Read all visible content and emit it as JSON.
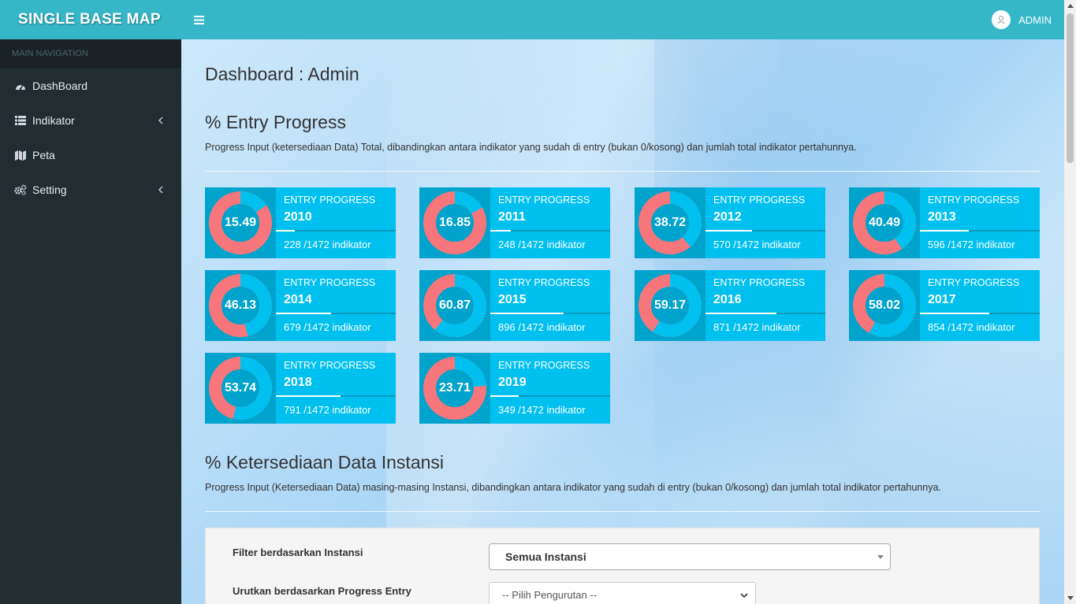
{
  "header": {
    "brand": "SINGLE BASE MAP",
    "user_name": "ADMIN"
  },
  "sidebar": {
    "section_label": "MAIN NAVIGATION",
    "items": [
      {
        "label": "DashBoard",
        "icon": "dashboard-icon",
        "has_children": false
      },
      {
        "label": "Indikator",
        "icon": "table-list-icon",
        "has_children": true
      },
      {
        "label": "Peta",
        "icon": "map-icon",
        "has_children": false
      },
      {
        "label": "Setting",
        "icon": "gears-icon",
        "has_children": true
      }
    ]
  },
  "main": {
    "page_title": "Dashboard : Admin",
    "entry_section": {
      "title": "% Entry Progress",
      "description": "Progress Input (ketersediaan Data) Total, dibandingkan antara indikator yang sudah di entry (bukan 0/kosong) dan jumlah total indikator pertahunnya."
    },
    "cards": [
      {
        "label": "ENTRY PROGRESS",
        "year": "2010",
        "percent": "15.49",
        "footer": "228 /1472 indikator"
      },
      {
        "label": "ENTRY PROGRESS",
        "year": "2011",
        "percent": "16.85",
        "footer": "248 /1472 indikator"
      },
      {
        "label": "ENTRY PROGRESS",
        "year": "2012",
        "percent": "38.72",
        "footer": "570 /1472 indikator"
      },
      {
        "label": "ENTRY PROGRESS",
        "year": "2013",
        "percent": "40.49",
        "footer": "596 /1472 indikator"
      },
      {
        "label": "ENTRY PROGRESS",
        "year": "2014",
        "percent": "46.13",
        "footer": "679 /1472 indikator"
      },
      {
        "label": "ENTRY PROGRESS",
        "year": "2015",
        "percent": "60.87",
        "footer": "896 /1472 indikator"
      },
      {
        "label": "ENTRY PROGRESS",
        "year": "2016",
        "percent": "59.17",
        "footer": "871 /1472 indikator"
      },
      {
        "label": "ENTRY PROGRESS",
        "year": "2017",
        "percent": "58.02",
        "footer": "854 /1472 indikator"
      },
      {
        "label": "ENTRY PROGRESS",
        "year": "2018",
        "percent": "53.74",
        "footer": "791 /1472 indikator"
      },
      {
        "label": "ENTRY PROGRESS",
        "year": "2019",
        "percent": "23.71",
        "footer": "349 /1472 indikator"
      }
    ],
    "instansi_section": {
      "title": "% Ketersediaan Data Instansi",
      "description": "Progress Input (Ketersediaan Data) masing-masing Instansi, dibandingkan antara indikator yang sudah di entry (bukan 0/kosong) dan jumlah total indikator pertahunnya."
    },
    "filter": {
      "instansi_label": "Filter berdasarkan Instansi",
      "instansi_value": "Semua Instansi",
      "sort_label": "Urutkan berdasarkan Progress Entry",
      "sort_value": "-- Pilih Pengurutan --"
    }
  },
  "colors": {
    "header": "#36b7c8",
    "sidebar": "#222d32",
    "card": "#00c0ef",
    "card_dark": "#00a3cb",
    "donut_filled": "#00c0ef",
    "donut_remaining": "#f7767c"
  }
}
